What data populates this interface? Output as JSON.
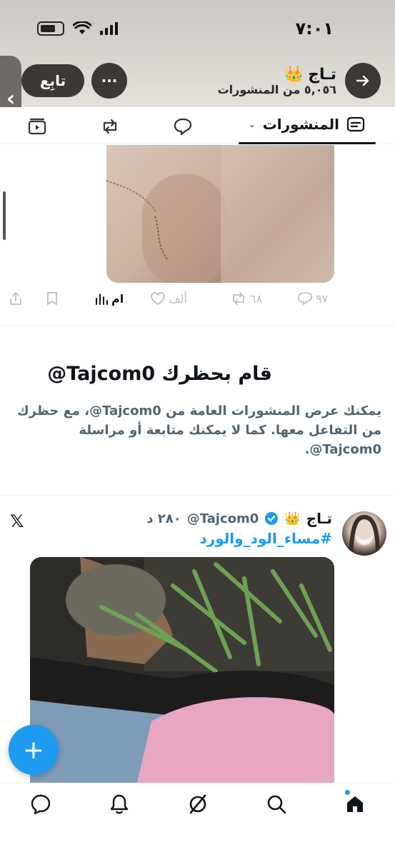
{
  "status_bar": {
    "time": "٧:٠١"
  },
  "header": {
    "name": "تـاج",
    "name_emoji": "👑",
    "posts_count": "٥,٠٥٦ من المنشورات",
    "follow_label": "تابِع",
    "more_label": "···"
  },
  "tabs": {
    "posts_label": "المنشورات"
  },
  "post1": {
    "replies": "٩٧",
    "reposts": "٦٨",
    "likes": "ألف",
    "views": "ام"
  },
  "blocked": {
    "title": "قام بحظرك Tajcom0@",
    "text": "يمكنك عرض المنشورات العامة من Tajcom0@، مع حظرك من التفاعل معها. كما لا يمكنك متابعة أو مراسلة Tajcom0@."
  },
  "post2": {
    "name": "تـاج",
    "name_emoji": "👑",
    "handle": "Tajcom0@",
    "time": "٢٨٠ د",
    "hashtag": "#مساء_الود_والورد",
    "source_logo": "𝕏"
  },
  "fab": {
    "label": "+"
  },
  "colors": {
    "accent": "#1d9bf0",
    "text": "#0f1419",
    "muted": "#536471",
    "header_bg": "#d8d4cf"
  },
  "icons": [
    "arrow-right-icon",
    "more-icon",
    "back-chevron-icon",
    "posts-tab-icon",
    "replies-tab-icon",
    "reposts-tab-icon",
    "media-tab-icon",
    "reply-icon",
    "repost-icon",
    "like-icon",
    "views-icon",
    "bookmark-icon",
    "share-icon",
    "verified-icon",
    "home-icon",
    "search-icon",
    "grok-icon",
    "notifications-icon",
    "messages-icon"
  ]
}
